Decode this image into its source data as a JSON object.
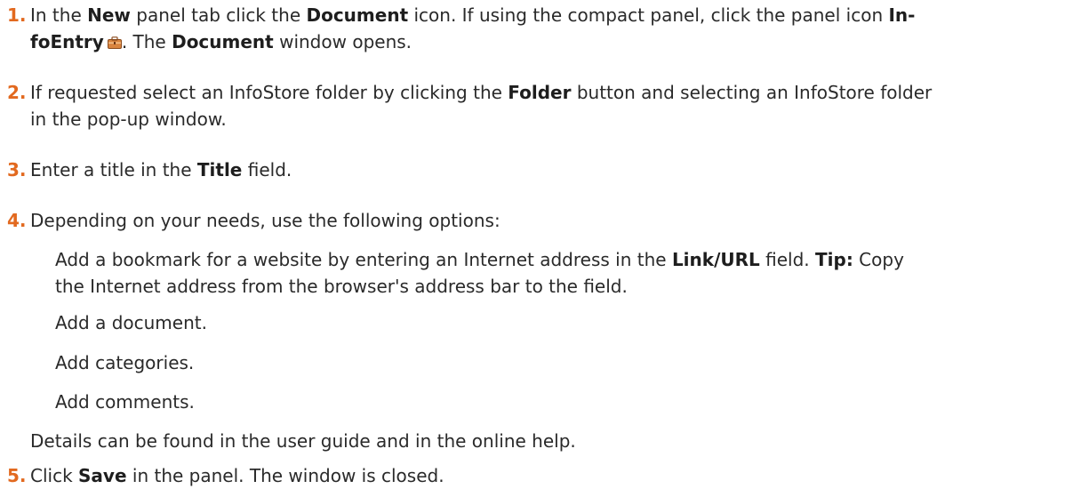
{
  "steps": [
    {
      "number": "1.",
      "s1": "In the ",
      "b1": "New",
      "s2": " panel tab click the ",
      "b2": "Document",
      "s3": " icon. If using the compact panel, click the panel icon ",
      "b3a": "In-",
      "b3b": "foEntry",
      "s4": ". The ",
      "b4": "Document",
      "s5": " window opens.",
      "icon": "infoentry-icon"
    },
    {
      "number": "2.",
      "s1": "If requested select an InfoStore folder by clicking the ",
      "b1": "Folder",
      "s2": " button and selecting an InfoStore folder",
      "s3": "in the pop-up window."
    },
    {
      "number": "3.",
      "s1": "Enter a title in the ",
      "b1": "Title",
      "s2": " field."
    },
    {
      "number": "4.",
      "s1": "Depending on your needs, use the following options:"
    },
    {
      "number": "5.",
      "s1": "Click ",
      "b1": "Save",
      "s2": " in the panel. The window is closed."
    }
  ],
  "options": [
    {
      "s1": "Add a bookmark for a website by entering an Internet address in the ",
      "b1": "Link/URL",
      "s2": " field. ",
      "b2": "Tip:",
      "s3": " Copy",
      "s4": "the Internet address from the browser's address bar to the field."
    },
    {
      "s1": "Add a document."
    },
    {
      "s1": "Add categories."
    },
    {
      "s1": "Add comments."
    }
  ],
  "details_note": "Details can be found in the user guide and in the online help."
}
